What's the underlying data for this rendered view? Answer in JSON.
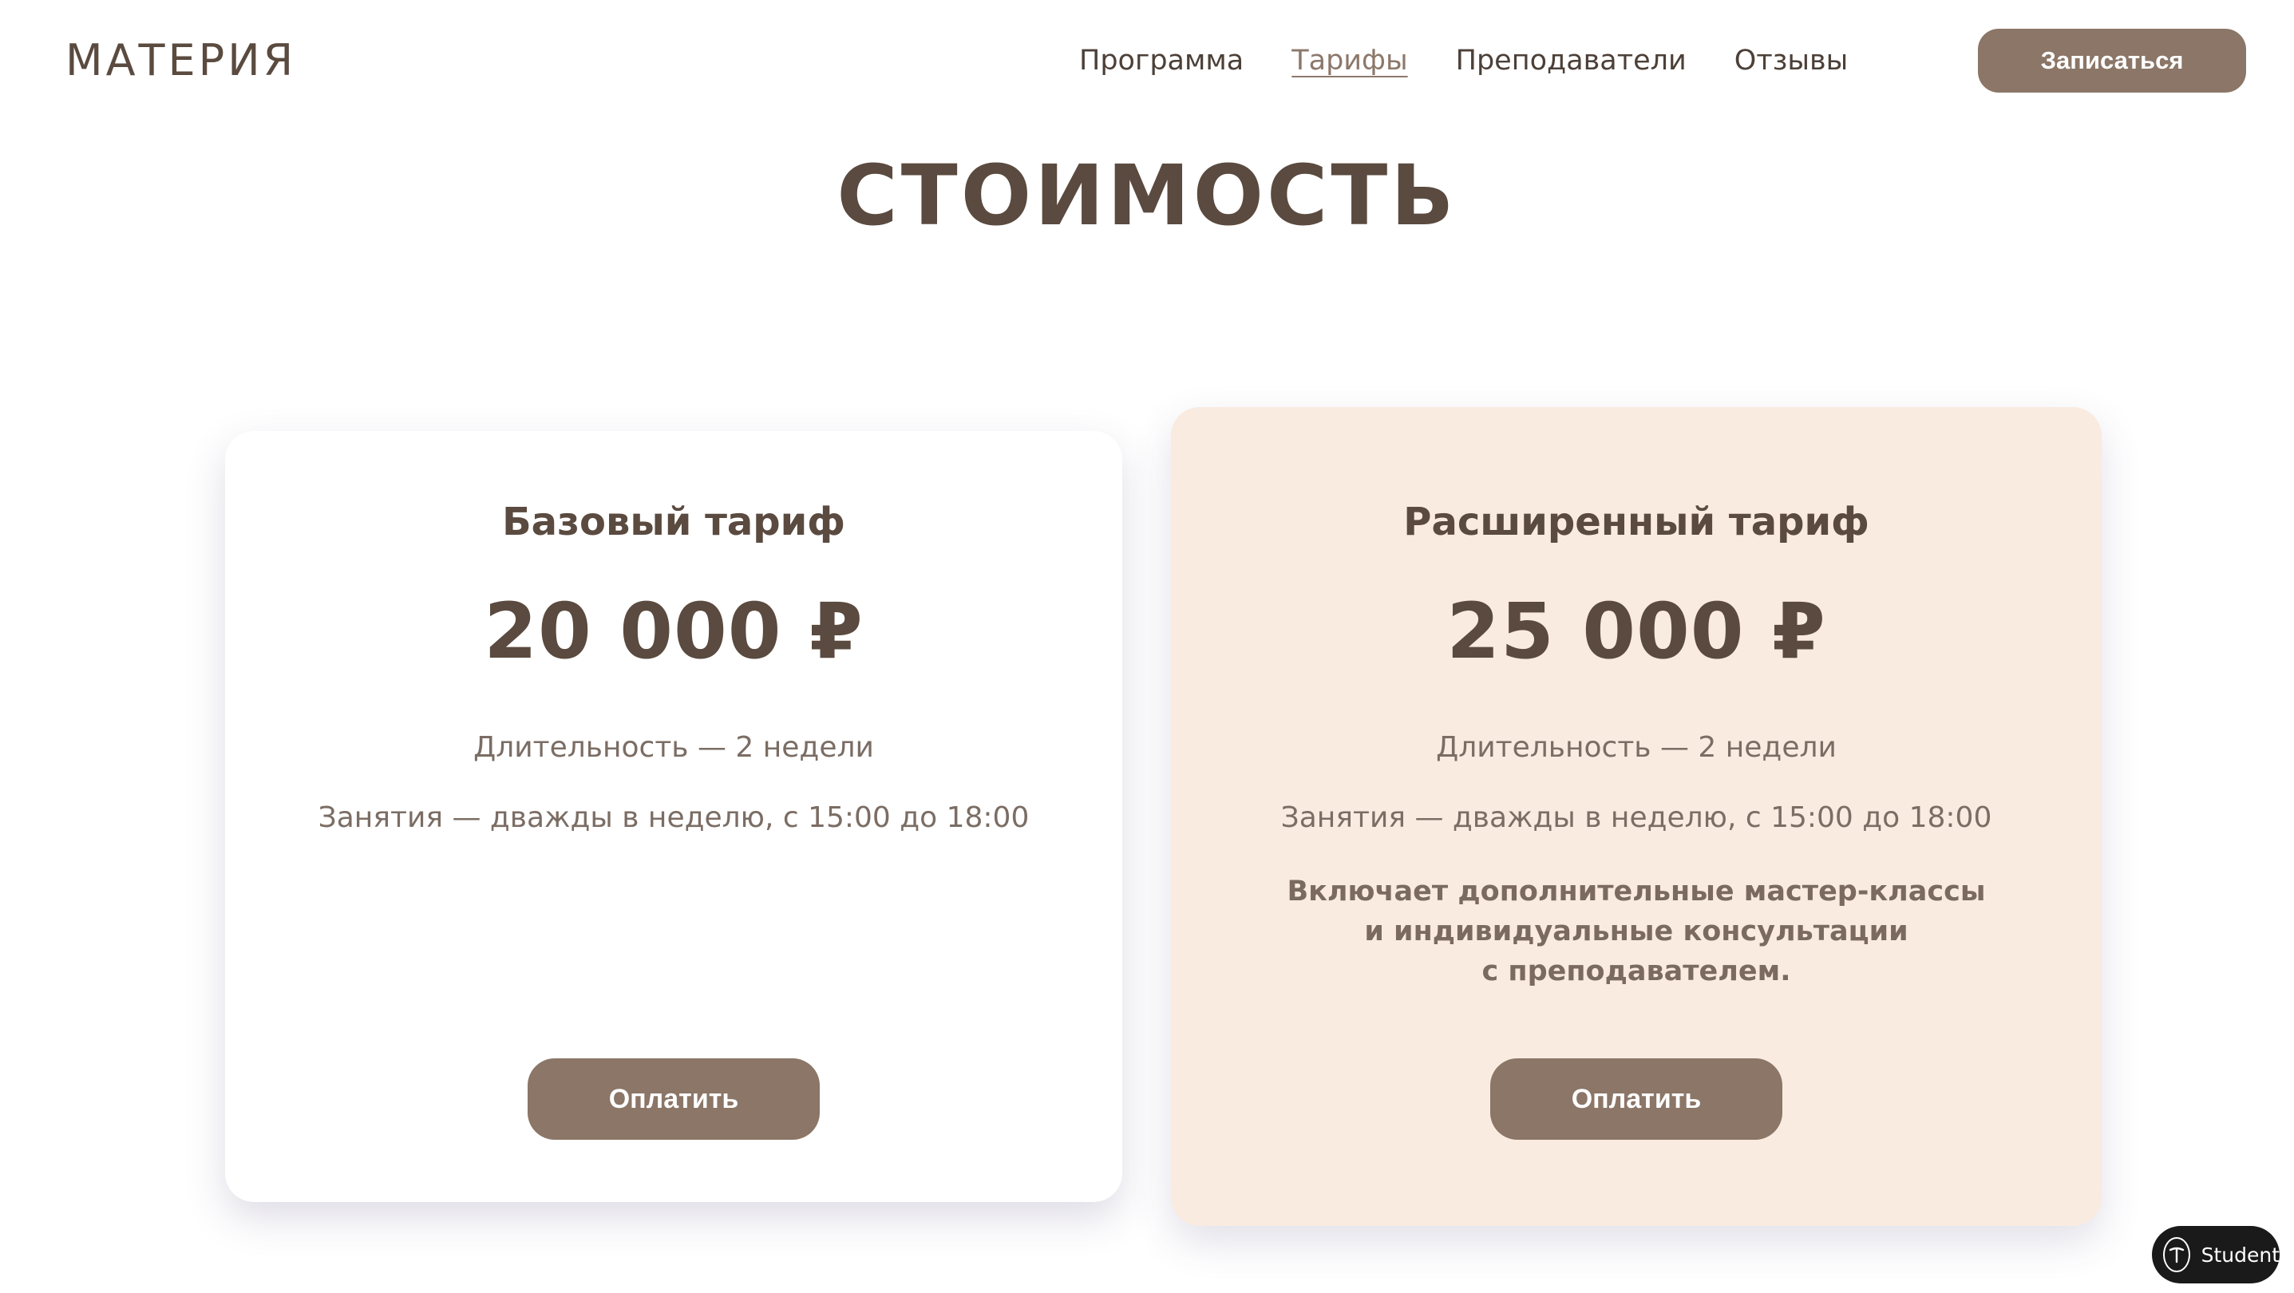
{
  "header": {
    "logo": "МАТЕРИЯ",
    "nav": [
      "Программа",
      "Тарифы",
      "Преподаватели",
      "Отзывы"
    ],
    "active_nav": "Тарифы",
    "cta_label": "Записаться"
  },
  "section": {
    "title": "СТОИМОСТЬ"
  },
  "plans": [
    {
      "name": "Базовый тариф",
      "price": "20 000 ₽",
      "duration": "Длительность — 2 недели",
      "schedule": "Занятия — дважды в неделю, с 15:00 до 18:00",
      "button_label": "Оплатить"
    },
    {
      "name": "Расширенный тариф",
      "price": "25 000 ₽",
      "duration": "Длительность — 2 недели",
      "schedule": "Занятия — дважды в неделю, с 15:00 до 18:00",
      "extra_lines": [
        "Включает дополнительные мастер-классы",
        "и индивидуальные консультации",
        "с преподавателем."
      ],
      "button_label": "Оплатить"
    }
  ],
  "badge": {
    "label": "Student",
    "icon": "t-logo-icon"
  },
  "colors": {
    "brand_brown": "#8b7667",
    "text_dark": "#5a4a3f",
    "card_highlight_bg": "#f9ebe0"
  }
}
